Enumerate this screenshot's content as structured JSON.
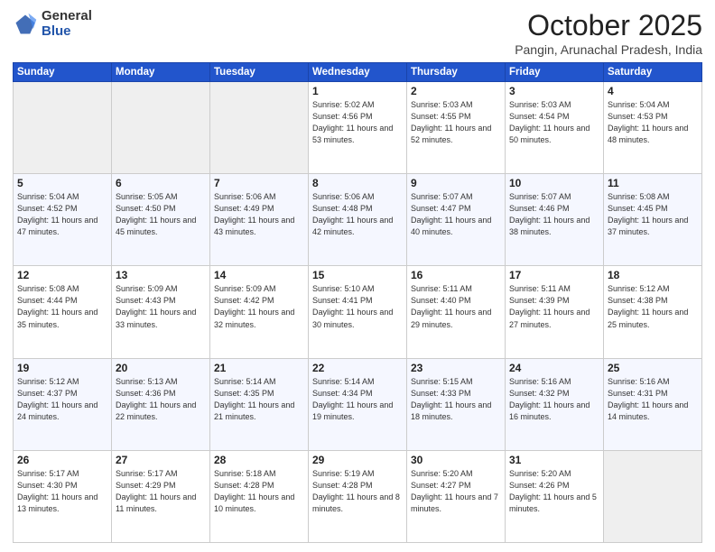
{
  "logo": {
    "general": "General",
    "blue": "Blue"
  },
  "header": {
    "month": "October 2025",
    "location": "Pangin, Arunachal Pradesh, India"
  },
  "weekdays": [
    "Sunday",
    "Monday",
    "Tuesday",
    "Wednesday",
    "Thursday",
    "Friday",
    "Saturday"
  ],
  "weeks": [
    [
      {
        "day": null
      },
      {
        "day": null
      },
      {
        "day": null
      },
      {
        "day": "1",
        "sunrise": "5:02 AM",
        "sunset": "4:56 PM",
        "daylight": "11 hours and 53 minutes."
      },
      {
        "day": "2",
        "sunrise": "5:03 AM",
        "sunset": "4:55 PM",
        "daylight": "11 hours and 52 minutes."
      },
      {
        "day": "3",
        "sunrise": "5:03 AM",
        "sunset": "4:54 PM",
        "daylight": "11 hours and 50 minutes."
      },
      {
        "day": "4",
        "sunrise": "5:04 AM",
        "sunset": "4:53 PM",
        "daylight": "11 hours and 48 minutes."
      }
    ],
    [
      {
        "day": "5",
        "sunrise": "5:04 AM",
        "sunset": "4:52 PM",
        "daylight": "11 hours and 47 minutes."
      },
      {
        "day": "6",
        "sunrise": "5:05 AM",
        "sunset": "4:50 PM",
        "daylight": "11 hours and 45 minutes."
      },
      {
        "day": "7",
        "sunrise": "5:06 AM",
        "sunset": "4:49 PM",
        "daylight": "11 hours and 43 minutes."
      },
      {
        "day": "8",
        "sunrise": "5:06 AM",
        "sunset": "4:48 PM",
        "daylight": "11 hours and 42 minutes."
      },
      {
        "day": "9",
        "sunrise": "5:07 AM",
        "sunset": "4:47 PM",
        "daylight": "11 hours and 40 minutes."
      },
      {
        "day": "10",
        "sunrise": "5:07 AM",
        "sunset": "4:46 PM",
        "daylight": "11 hours and 38 minutes."
      },
      {
        "day": "11",
        "sunrise": "5:08 AM",
        "sunset": "4:45 PM",
        "daylight": "11 hours and 37 minutes."
      }
    ],
    [
      {
        "day": "12",
        "sunrise": "5:08 AM",
        "sunset": "4:44 PM",
        "daylight": "11 hours and 35 minutes."
      },
      {
        "day": "13",
        "sunrise": "5:09 AM",
        "sunset": "4:43 PM",
        "daylight": "11 hours and 33 minutes."
      },
      {
        "day": "14",
        "sunrise": "5:09 AM",
        "sunset": "4:42 PM",
        "daylight": "11 hours and 32 minutes."
      },
      {
        "day": "15",
        "sunrise": "5:10 AM",
        "sunset": "4:41 PM",
        "daylight": "11 hours and 30 minutes."
      },
      {
        "day": "16",
        "sunrise": "5:11 AM",
        "sunset": "4:40 PM",
        "daylight": "11 hours and 29 minutes."
      },
      {
        "day": "17",
        "sunrise": "5:11 AM",
        "sunset": "4:39 PM",
        "daylight": "11 hours and 27 minutes."
      },
      {
        "day": "18",
        "sunrise": "5:12 AM",
        "sunset": "4:38 PM",
        "daylight": "11 hours and 25 minutes."
      }
    ],
    [
      {
        "day": "19",
        "sunrise": "5:12 AM",
        "sunset": "4:37 PM",
        "daylight": "11 hours and 24 minutes."
      },
      {
        "day": "20",
        "sunrise": "5:13 AM",
        "sunset": "4:36 PM",
        "daylight": "11 hours and 22 minutes."
      },
      {
        "day": "21",
        "sunrise": "5:14 AM",
        "sunset": "4:35 PM",
        "daylight": "11 hours and 21 minutes."
      },
      {
        "day": "22",
        "sunrise": "5:14 AM",
        "sunset": "4:34 PM",
        "daylight": "11 hours and 19 minutes."
      },
      {
        "day": "23",
        "sunrise": "5:15 AM",
        "sunset": "4:33 PM",
        "daylight": "11 hours and 18 minutes."
      },
      {
        "day": "24",
        "sunrise": "5:16 AM",
        "sunset": "4:32 PM",
        "daylight": "11 hours and 16 minutes."
      },
      {
        "day": "25",
        "sunrise": "5:16 AM",
        "sunset": "4:31 PM",
        "daylight": "11 hours and 14 minutes."
      }
    ],
    [
      {
        "day": "26",
        "sunrise": "5:17 AM",
        "sunset": "4:30 PM",
        "daylight": "11 hours and 13 minutes."
      },
      {
        "day": "27",
        "sunrise": "5:17 AM",
        "sunset": "4:29 PM",
        "daylight": "11 hours and 11 minutes."
      },
      {
        "day": "28",
        "sunrise": "5:18 AM",
        "sunset": "4:28 PM",
        "daylight": "11 hours and 10 minutes."
      },
      {
        "day": "29",
        "sunrise": "5:19 AM",
        "sunset": "4:28 PM",
        "daylight": "11 hours and 8 minutes."
      },
      {
        "day": "30",
        "sunrise": "5:20 AM",
        "sunset": "4:27 PM",
        "daylight": "11 hours and 7 minutes."
      },
      {
        "day": "31",
        "sunrise": "5:20 AM",
        "sunset": "4:26 PM",
        "daylight": "11 hours and 5 minutes."
      },
      {
        "day": null
      }
    ]
  ]
}
